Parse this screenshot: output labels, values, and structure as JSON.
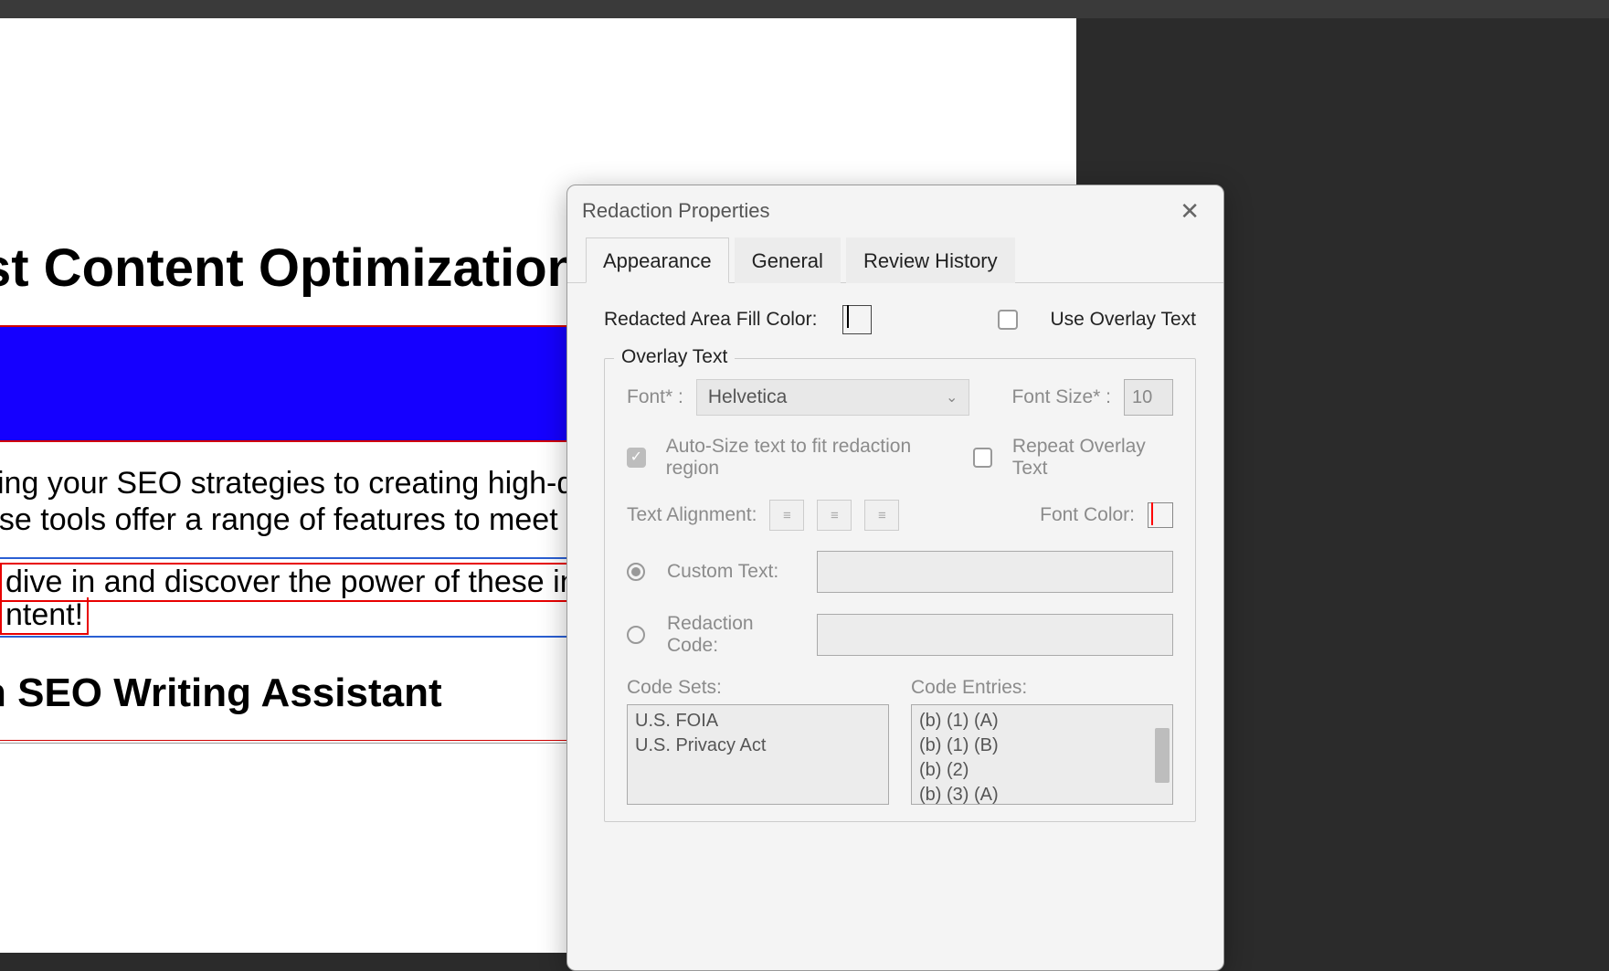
{
  "document": {
    "heading": "st Content Optimization",
    "body_line1": "cing your SEO strategies to creating high-quality cor",
    "body_line2": "ese tools offer a range of features to meet your spec",
    "marked_line1": " dive in and discover the power of these innovative t",
    "marked_line2": "ntent!",
    "subheading": "h SEO Writing Assistant"
  },
  "dialog": {
    "title": "Redaction Properties",
    "tabs": {
      "appearance": "Appearance",
      "general": "General",
      "review_history": "Review History"
    },
    "appearance": {
      "fill_label": "Redacted Area Fill Color:",
      "fill_color": "#000000",
      "use_overlay_label": "Use Overlay Text",
      "use_overlay_checked": false,
      "overlay_group_label": "Overlay Text",
      "font_label": "Font* :",
      "font_value": "Helvetica",
      "font_size_label": "Font Size* :",
      "font_size_value": "10",
      "autosize_label": "Auto-Size text to fit redaction region",
      "autosize_checked": true,
      "repeat_label": "Repeat Overlay Text",
      "repeat_checked": false,
      "align_label": "Text Alignment:",
      "font_color_label": "Font Color:",
      "font_color": "#ff0000",
      "custom_text_label": "Custom Text:",
      "custom_text_value": "",
      "redaction_code_label": "Redaction Code:",
      "code_sets_label": "Code Sets:",
      "code_entries_label": "Code Entries:",
      "code_sets": [
        "U.S. FOIA",
        "U.S. Privacy Act"
      ],
      "code_entries": [
        "(b) (1) (A)",
        "(b) (1) (B)",
        "(b) (2)",
        "(b) (3) (A)"
      ]
    }
  }
}
